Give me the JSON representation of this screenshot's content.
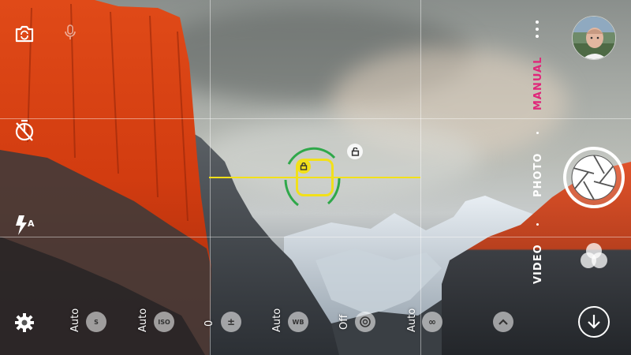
{
  "app": {
    "left_icons": [
      "switch-camera-icon",
      "timer-off-icon",
      "flash-auto-icon",
      "settings-icon"
    ],
    "mic_icon": "microphone-icon"
  },
  "manual_controls": [
    {
      "label": "Auto",
      "icon": "shutter-speed-icon",
      "icon_text": "S"
    },
    {
      "label": "Auto",
      "icon": "iso-icon",
      "icon_text": "ISO"
    },
    {
      "label": "0",
      "icon": "exposure-compensation-icon",
      "icon_text": "±"
    },
    {
      "label": "Auto",
      "icon": "white-balance-icon",
      "icon_text": "WB"
    },
    {
      "label": "Off",
      "icon": "focus-peaking-icon",
      "icon_text": ""
    },
    {
      "label": "Auto",
      "icon": "manual-focus-icon",
      "icon_text": "∞"
    }
  ],
  "modes": {
    "manual": "MANUAL",
    "photo": "PHOTO",
    "video": "VIDEO"
  },
  "colors": {
    "accent": "#e0267a",
    "focus": "#f2e01a",
    "focus_ring": "#2fa84a"
  }
}
